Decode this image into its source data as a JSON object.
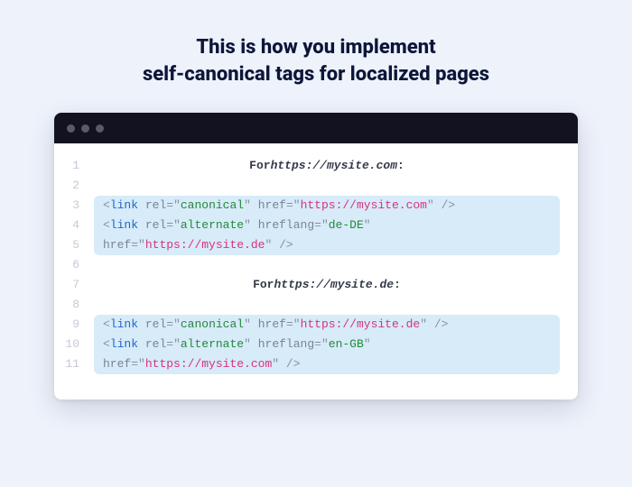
{
  "heading_line1": "This is how you implement",
  "heading_line2": "self-canonical tags for localized pages",
  "colors": {
    "page_bg": "#eef2fb",
    "window_bg": "#ffffff",
    "titlebar_bg": "#121220",
    "highlight_bg": "#d7ebf8",
    "text": "#0c1638",
    "tag": "#1e66d0",
    "string": "#228a3a",
    "url": "#d63384"
  },
  "gutter_lines": [
    "1",
    "2",
    "3",
    "4",
    "5",
    "6",
    "7",
    "8",
    "9",
    "10",
    "11"
  ],
  "blocks": [
    {
      "comment_label": "For ",
      "comment_url": "https://mysite.com",
      "comment_suffix": ":",
      "lines": [
        [
          {
            "t": "punc",
            "v": "<"
          },
          {
            "t": "tag",
            "v": "link"
          },
          {
            "t": "plain",
            "v": " "
          },
          {
            "t": "attr",
            "v": "rel"
          },
          {
            "t": "eq",
            "v": "="
          },
          {
            "t": "punc",
            "v": "\""
          },
          {
            "t": "str",
            "v": "canonical"
          },
          {
            "t": "punc",
            "v": "\""
          },
          {
            "t": "plain",
            "v": " "
          },
          {
            "t": "attr",
            "v": "href"
          },
          {
            "t": "eq",
            "v": "="
          },
          {
            "t": "punc",
            "v": "\""
          },
          {
            "t": "url",
            "v": "https://mysite.com"
          },
          {
            "t": "punc",
            "v": "\""
          },
          {
            "t": "plain",
            "v": " "
          },
          {
            "t": "punc",
            "v": "/>"
          }
        ],
        [
          {
            "t": "punc",
            "v": "<"
          },
          {
            "t": "tag",
            "v": "link"
          },
          {
            "t": "plain",
            "v": " "
          },
          {
            "t": "attr",
            "v": "rel"
          },
          {
            "t": "eq",
            "v": "="
          },
          {
            "t": "punc",
            "v": "\""
          },
          {
            "t": "str",
            "v": "alternate"
          },
          {
            "t": "punc",
            "v": "\""
          },
          {
            "t": "plain",
            "v": " "
          },
          {
            "t": "attr",
            "v": "hreflang"
          },
          {
            "t": "eq",
            "v": "="
          },
          {
            "t": "punc",
            "v": "\""
          },
          {
            "t": "str",
            "v": "de-DE"
          },
          {
            "t": "punc",
            "v": "\""
          }
        ],
        [
          {
            "t": "attr",
            "v": "href"
          },
          {
            "t": "eq",
            "v": "="
          },
          {
            "t": "punc",
            "v": "\""
          },
          {
            "t": "url",
            "v": "https://mysite.de"
          },
          {
            "t": "punc",
            "v": "\""
          },
          {
            "t": "plain",
            "v": " "
          },
          {
            "t": "punc",
            "v": "/>"
          }
        ]
      ]
    },
    {
      "comment_label": "For ",
      "comment_url": "https://mysite.de",
      "comment_suffix": ":",
      "lines": [
        [
          {
            "t": "punc",
            "v": "<"
          },
          {
            "t": "tag",
            "v": "link"
          },
          {
            "t": "plain",
            "v": " "
          },
          {
            "t": "attr",
            "v": "rel"
          },
          {
            "t": "eq",
            "v": "="
          },
          {
            "t": "punc",
            "v": "\""
          },
          {
            "t": "str",
            "v": "canonical"
          },
          {
            "t": "punc",
            "v": "\""
          },
          {
            "t": "plain",
            "v": " "
          },
          {
            "t": "attr",
            "v": "href"
          },
          {
            "t": "eq",
            "v": "="
          },
          {
            "t": "punc",
            "v": "\""
          },
          {
            "t": "url",
            "v": "https://mysite.de"
          },
          {
            "t": "punc",
            "v": "\""
          },
          {
            "t": "plain",
            "v": " "
          },
          {
            "t": "punc",
            "v": "/>"
          }
        ],
        [
          {
            "t": "punc",
            "v": "<"
          },
          {
            "t": "tag",
            "v": "link"
          },
          {
            "t": "plain",
            "v": " "
          },
          {
            "t": "attr",
            "v": "rel"
          },
          {
            "t": "eq",
            "v": "="
          },
          {
            "t": "punc",
            "v": "\""
          },
          {
            "t": "str",
            "v": "alternate"
          },
          {
            "t": "punc",
            "v": "\""
          },
          {
            "t": "plain",
            "v": " "
          },
          {
            "t": "attr",
            "v": "hreflang"
          },
          {
            "t": "eq",
            "v": "="
          },
          {
            "t": "punc",
            "v": "\""
          },
          {
            "t": "str",
            "v": "en-GB"
          },
          {
            "t": "punc",
            "v": "\""
          }
        ],
        [
          {
            "t": "attr",
            "v": "href"
          },
          {
            "t": "eq",
            "v": "="
          },
          {
            "t": "punc",
            "v": "\""
          },
          {
            "t": "url",
            "v": "https://mysite.com"
          },
          {
            "t": "punc",
            "v": "\""
          },
          {
            "t": "plain",
            "v": " "
          },
          {
            "t": "punc",
            "v": "/>"
          }
        ]
      ]
    }
  ]
}
